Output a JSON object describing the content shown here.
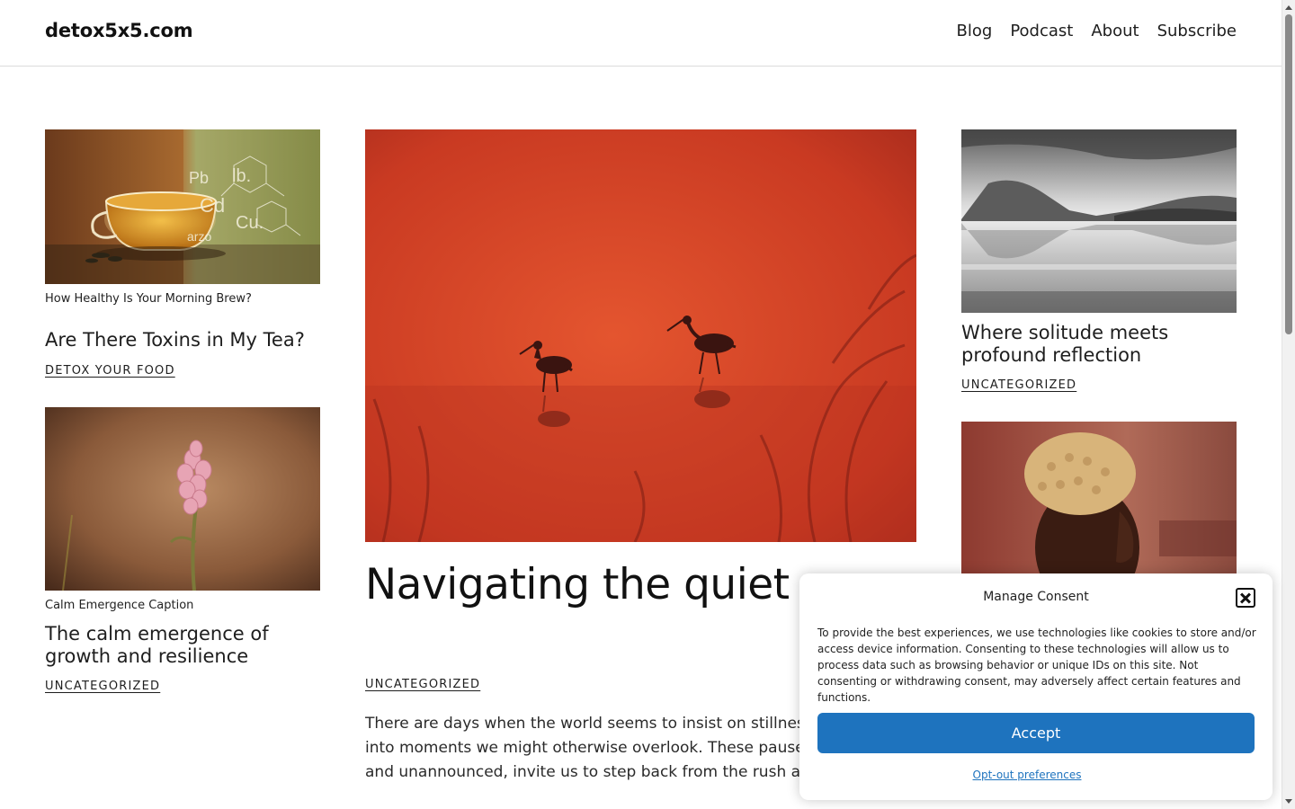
{
  "header": {
    "brand": "detox5x5.com",
    "nav": [
      "Blog",
      "Podcast",
      "About",
      "Subscribe"
    ]
  },
  "posts": {
    "tea": {
      "caption": "How Healthy Is Your Morning Brew?",
      "title": "Are There Toxins in My Tea?",
      "category": "DETOX YOUR FOOD",
      "image_labels": [
        "Pb",
        "lb.",
        "Cd",
        "Cu.",
        "arzo"
      ]
    },
    "flower": {
      "caption": "Calm Emergence Caption",
      "title": "The calm emergence of growth and resilience",
      "category": "UNCATEGORIZED"
    },
    "hero": {
      "title": "Navigating the quiet moments within the noise",
      "category": "UNCATEGORIZED",
      "excerpt": [
        "There are days when the world seems to insist on stillness, pulling us",
        "into moments we might otherwise overlook. These pauses, often quiet",
        "and unannounced, invite us to step back from the rush and listen."
      ]
    },
    "lake": {
      "title": "Where solitude meets profound reflection",
      "category": "UNCATEGORIZED"
    }
  },
  "consent": {
    "title": "Manage Consent",
    "text": "To provide the best experiences, we use technologies like cookies to store and/or access device information. Consenting to these technologies will allow us to process data such as browsing behavior or unique IDs on this site. Not consenting or withdrawing consent, may adversely affect certain features and functions.",
    "accept_label": "Accept",
    "optout_label": "Opt-out preferences"
  },
  "colors": {
    "accent": "#1e73be",
    "hero_red": "#d9472a"
  }
}
